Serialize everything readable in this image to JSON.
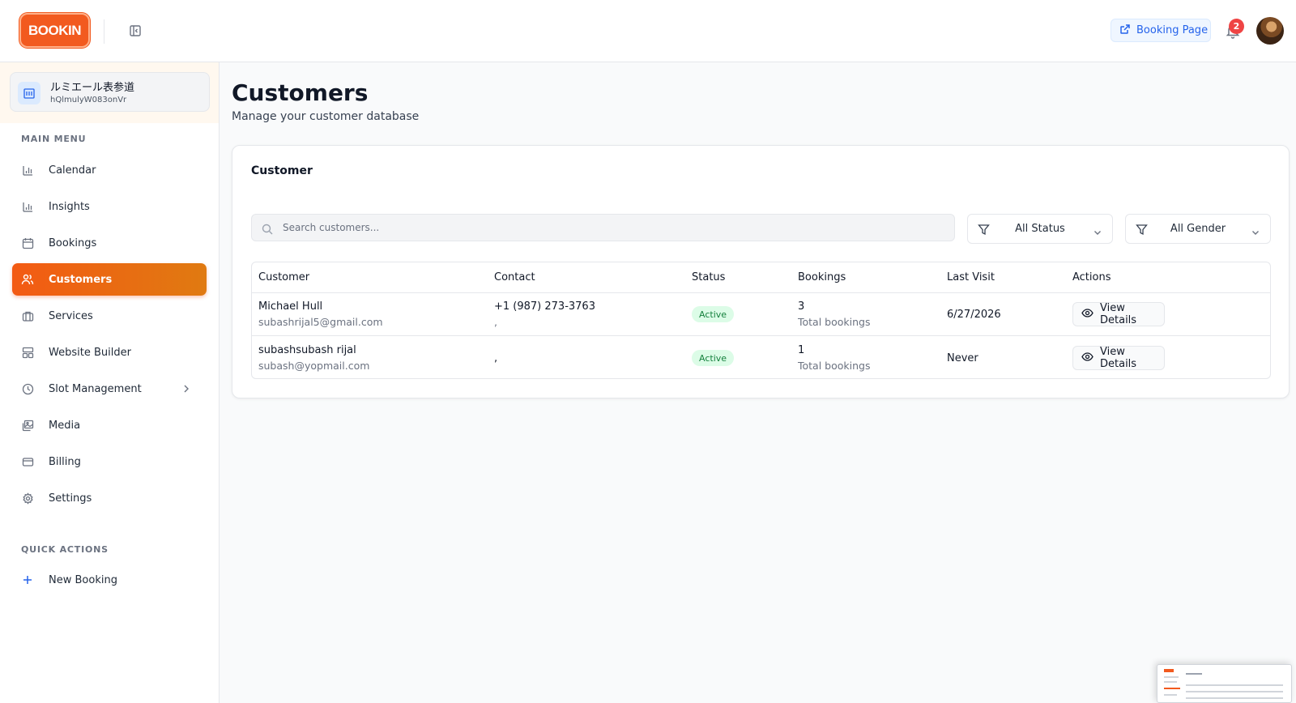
{
  "header": {
    "logo_text": "BOOKIN",
    "booking_page_label": "Booking Page",
    "notification_count": "2",
    "accent_color": "#f25a1f",
    "link_color": "#2563eb"
  },
  "business": {
    "name": "ルミエール表参道",
    "id": "hQlmulyW083onVr"
  },
  "sidebar": {
    "main_menu_label": "MAIN MENU",
    "items": [
      {
        "label": "Calendar",
        "icon": "bar-chart-icon"
      },
      {
        "label": "Insights",
        "icon": "bar-chart-icon"
      },
      {
        "label": "Bookings",
        "icon": "calendar-icon"
      },
      {
        "label": "Customers",
        "icon": "users-icon",
        "active": true
      },
      {
        "label": "Services",
        "icon": "briefcase-icon"
      },
      {
        "label": "Website Builder",
        "icon": "layout-icon"
      },
      {
        "label": "Slot Management",
        "icon": "clock-icon"
      },
      {
        "label": "Media",
        "icon": "images-icon"
      },
      {
        "label": "Billing",
        "icon": "credit-card-icon"
      },
      {
        "label": "Settings",
        "icon": "gear-icon"
      }
    ],
    "quick_actions_label": "QUICK ACTIONS",
    "quick_actions": [
      {
        "label": "New Booking",
        "icon": "plus-icon"
      }
    ]
  },
  "page": {
    "title": "Customers",
    "subtitle": "Manage your customer database"
  },
  "customer_card": {
    "title": "Customer",
    "search_placeholder": "Search customers...",
    "status_filter": "All Status",
    "gender_filter": "All Gender",
    "columns": [
      "Customer",
      "Contact",
      "Status",
      "Bookings",
      "Last Visit",
      "Actions"
    ],
    "rows": [
      {
        "name": "Michael Hull",
        "email": "subashrijal5@gmail.com",
        "phone": "+1 (987) 273-3763",
        "contact_sub": ",",
        "status": "Active",
        "bookings": "3",
        "bookings_sub": "Total bookings",
        "last_visit": "6/27/2026",
        "action": "View Details"
      },
      {
        "name": "subashsubash rijal",
        "email": "subash@yopmail.com",
        "phone": "",
        "contact_sub": ",",
        "status": "Active",
        "bookings": "1",
        "bookings_sub": "Total bookings",
        "last_visit": "Never",
        "action": "View Details"
      }
    ]
  }
}
